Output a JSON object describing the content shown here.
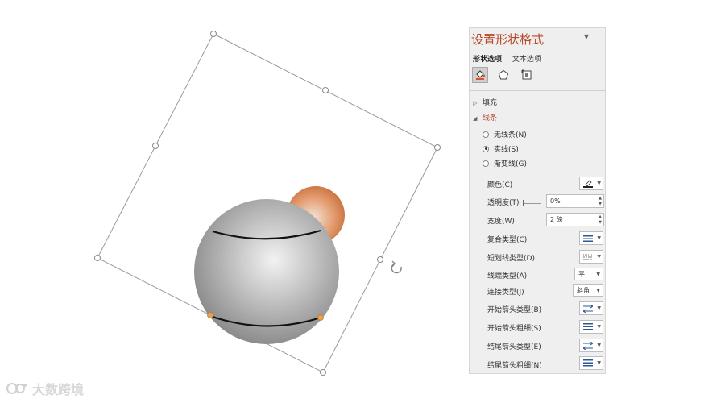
{
  "panel": {
    "title": "设置形状格式",
    "menu_caret": "▼",
    "tabs": [
      "形状选项",
      "文本选项"
    ],
    "sections": {
      "fill": "填充",
      "line": "线条"
    },
    "line_options": {
      "none": "无线条(N)",
      "solid": "实线(S)",
      "gradient": "渐变线(G)",
      "selected": "solid"
    },
    "props": {
      "color": "颜色(C)",
      "transparency": "透明度(T)",
      "transparency_value": "0%",
      "width": "宽度(W)",
      "width_value": "2 磅",
      "compound": "复合类型(C)",
      "dash": "短划线类型(D)",
      "cap": "线端类型(A)",
      "cap_value": "平",
      "join": "连接类型(J)",
      "join_value": "斜角",
      "begin_arrow_type": "开始箭头类型(B)",
      "begin_arrow_size": "开始箭头粗细(S)",
      "end_arrow_type": "结尾箭头类型(E)",
      "end_arrow_size": "结尾箭头粗细(N)"
    }
  },
  "watermark": {
    "text": "大数跨境"
  },
  "colors": {
    "accent": "#b7472a",
    "handle_orange": "#e8a054",
    "sphere_orange": "#d9804a"
  }
}
